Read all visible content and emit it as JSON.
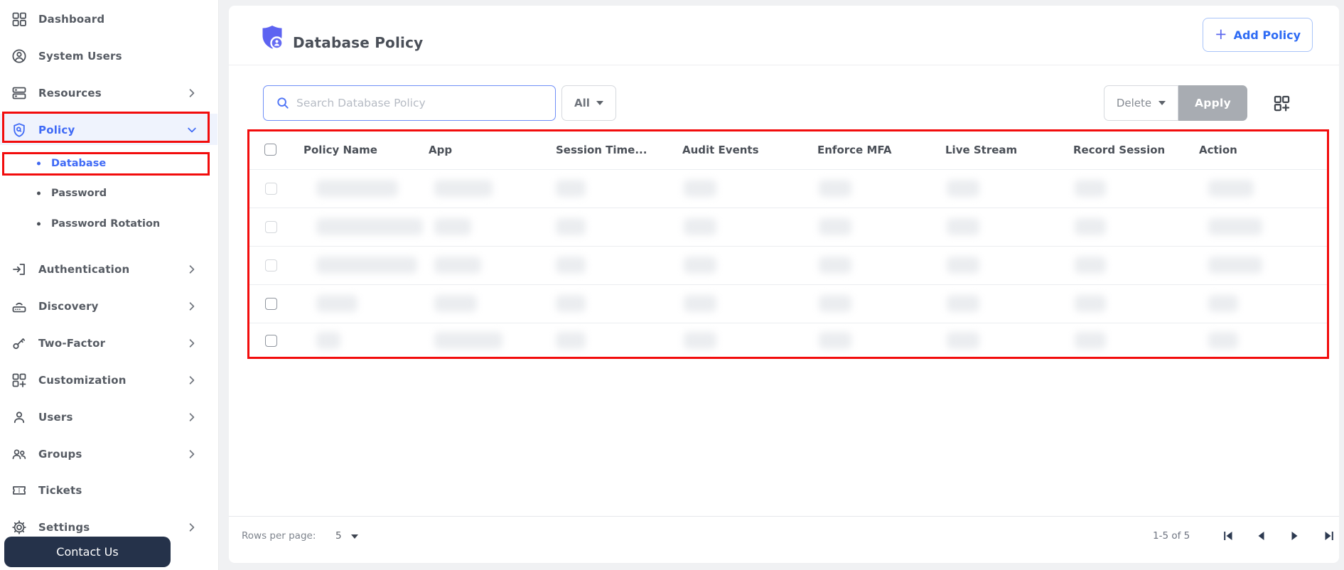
{
  "sidebar": {
    "items": [
      {
        "label": "Dashboard"
      },
      {
        "label": "System Users"
      },
      {
        "label": "Resources"
      },
      {
        "label": "Policy"
      },
      {
        "label": "Authentication"
      },
      {
        "label": "Discovery"
      },
      {
        "label": "Two-Factor"
      },
      {
        "label": "Customization"
      },
      {
        "label": "Users"
      },
      {
        "label": "Groups"
      },
      {
        "label": "Tickets"
      },
      {
        "label": "Settings"
      }
    ],
    "policy_subitems": [
      {
        "label": "Database"
      },
      {
        "label": "Password"
      },
      {
        "label": "Password Rotation"
      }
    ],
    "contact_button_label": "Contact Us"
  },
  "header": {
    "title": "Database Policy",
    "add_button_plus": "+",
    "add_button_label": "Add Policy"
  },
  "toolbar": {
    "search_placeholder": "Search Database Policy",
    "filter_selected": "All",
    "bulk_action_selected": "Delete",
    "apply_label": "Apply"
  },
  "table": {
    "columns": [
      "Policy Name",
      "App",
      "Session Time...",
      "Audit Events",
      "Enforce MFA",
      "Live Stream",
      "Record Session",
      "Action"
    ],
    "row_count": 5,
    "rows_state": "redacted-blurred"
  },
  "pagination": {
    "rows_per_page_label": "Rows per page:",
    "rows_per_page_value": "5",
    "range_label": "1-5 of 5"
  },
  "colors": {
    "accent_blue": "#3f6af6",
    "header_icon_indigo": "#5d63f1",
    "annotation_red": "#f20c0c",
    "apply_button_gray": "#a8acb2",
    "contact_button_navy": "#25324a"
  }
}
